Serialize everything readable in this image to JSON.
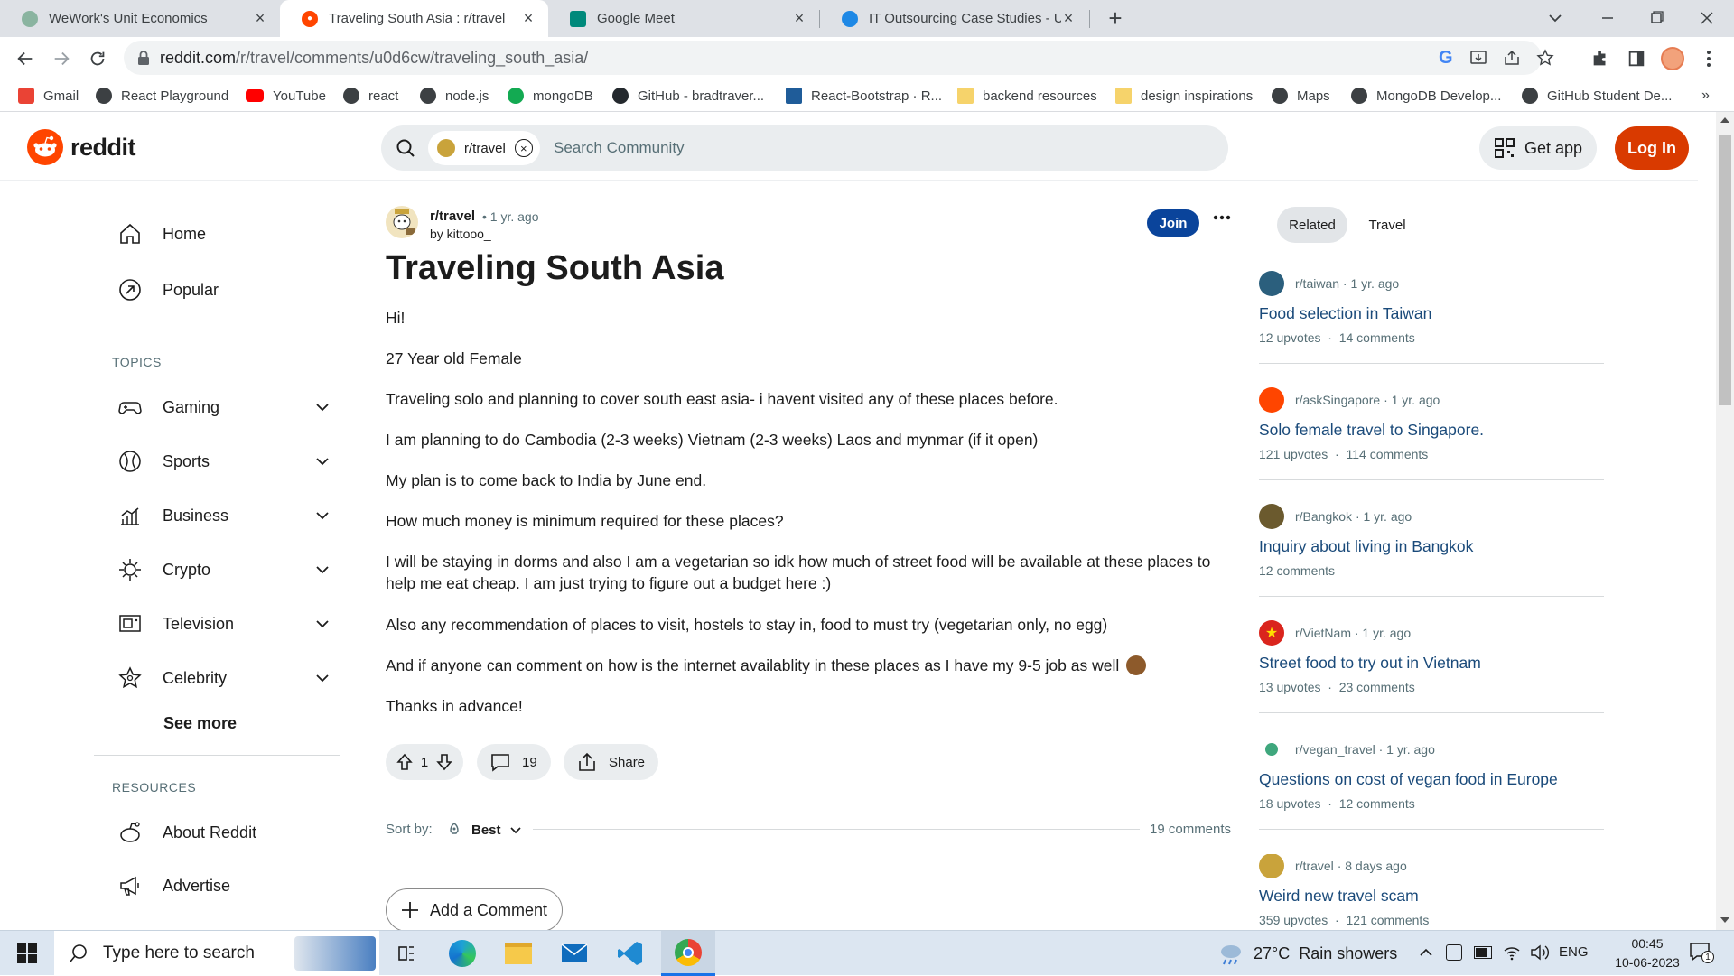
{
  "browser": {
    "tabs": [
      {
        "title": "WeWork's Unit Economics",
        "active": false,
        "favicon_color": "#8ab4a0"
      },
      {
        "title": "Traveling South Asia : r/travel",
        "active": true,
        "favicon_color": "#ff4500"
      },
      {
        "title": "Google Meet",
        "active": false,
        "favicon_color": "#00897b"
      },
      {
        "title": "IT Outsourcing Case Studies - US",
        "active": false,
        "favicon_color": "#1e88e5"
      }
    ],
    "url_host": "reddit.com",
    "url_path": "/r/travel/comments/u0d6cw/traveling_south_asia/",
    "bookmarks": [
      {
        "label": "Gmail",
        "color": "#ea4335"
      },
      {
        "label": "React Playground",
        "color": "#3c4043"
      },
      {
        "label": "YouTube",
        "color": "#ff0000"
      },
      {
        "label": "react",
        "color": "#3c4043"
      },
      {
        "label": "node.js",
        "color": "#3c4043"
      },
      {
        "label": "mongoDB",
        "color": "#13aa52"
      },
      {
        "label": "GitHub - bradtraver...",
        "color": "#24292e"
      },
      {
        "label": "React-Bootstrap · R...",
        "color": "#1f5c99"
      },
      {
        "label": "backend resources",
        "color": "#f6d36b"
      },
      {
        "label": "design inspirations",
        "color": "#f6d36b"
      },
      {
        "label": "Maps",
        "color": "#3c4043"
      },
      {
        "label": "MongoDB Develop...",
        "color": "#3c4043"
      },
      {
        "label": "GitHub Student De...",
        "color": "#3c4043"
      }
    ]
  },
  "reddit": {
    "brand": "reddit",
    "search_chip": "r/travel",
    "search_placeholder": "Search Community",
    "get_app": "Get app",
    "login": "Log In",
    "accent": "#d93a00"
  },
  "sidebar": {
    "home": "Home",
    "popular": "Popular",
    "topics_heading": "TOPICS",
    "topics": [
      {
        "label": "Gaming",
        "icon": "gamepad-icon"
      },
      {
        "label": "Sports",
        "icon": "ball-icon"
      },
      {
        "label": "Business",
        "icon": "chart-icon"
      },
      {
        "label": "Crypto",
        "icon": "crypto-icon"
      },
      {
        "label": "Television",
        "icon": "tv-icon"
      },
      {
        "label": "Celebrity",
        "icon": "star-icon"
      }
    ],
    "see_more": "See more",
    "resources_heading": "RESOURCES",
    "resources": [
      {
        "label": "About Reddit",
        "icon": "reddit-alien-icon"
      },
      {
        "label": "Advertise",
        "icon": "megaphone-icon"
      }
    ]
  },
  "post": {
    "subreddit": "r/travel",
    "age": "• 1 yr. ago",
    "author": "by kittooo_",
    "join": "Join",
    "title": "Traveling South Asia",
    "paragraphs": [
      "Hi!",
      "27 Year old Female",
      "Traveling solo and planning to cover south east asia- i havent visited any of these places before.",
      "I am planning to do Cambodia (2-3 weeks) Vietnam (2-3 weeks) Laos and mynmar (if it open)",
      "My plan is to come back to India by June end.",
      "How much money is minimum required for these places?",
      "I will be staying in dorms and also I am a vegetarian so idk how much of street food will be available at these places to help me eat cheap. I am just trying to figure out a budget here :)",
      "Also any recommendation of places to visit, hostels to stay in, food to must try (vegetarian only, no egg)",
      "And if anyone can comment on how is the internet availablity in these places as I have my 9-5 job as well",
      "Thanks in advance!"
    ],
    "votes": "1",
    "comments_count": "19",
    "share": "Share",
    "sort_label": "Sort by:",
    "sort_value": "Best",
    "comments_total": "19 comments",
    "add_comment": "Add a Comment"
  },
  "related": {
    "tabs": [
      "Related",
      "Travel"
    ],
    "items": [
      {
        "sub": "r/taiwan",
        "age": "· 1 yr. ago",
        "title": "Food selection in Taiwan",
        "meta": "12 upvotes  ·  14 comments",
        "avatar": "#2b5f7d"
      },
      {
        "sub": "r/askSingapore",
        "age": "· 1 yr. ago",
        "title": "Solo female travel to Singapore.",
        "meta": "121 upvotes  ·  114 comments",
        "avatar": "#ff4500"
      },
      {
        "sub": "r/Bangkok",
        "age": "· 1 yr. ago",
        "title": "Inquiry about living in Bangkok",
        "meta": "12 comments",
        "avatar": "#6b5a2e"
      },
      {
        "sub": "r/VietNam",
        "age": "· 1 yr. ago",
        "title": "Street food to try out in Vietnam",
        "meta": "13 upvotes  ·  23 comments",
        "avatar": "#da251d"
      },
      {
        "sub": "r/vegan_travel",
        "age": "· 1 yr. ago",
        "title": "Questions on cost of vegan food in Europe",
        "meta": "18 upvotes  ·  12 comments",
        "avatar": "#3fa77d"
      },
      {
        "sub": "r/travel",
        "age": "· 8 days ago",
        "title": "Weird new travel scam",
        "meta": "359 upvotes  ·  121 comments",
        "avatar": "#c9a33b"
      }
    ]
  },
  "taskbar": {
    "search_placeholder": "Type here to search",
    "weather": "27°C  Rain showers",
    "lang": "ENG",
    "time": "00:45",
    "date": "10-06-2023",
    "notif_count": "1"
  }
}
